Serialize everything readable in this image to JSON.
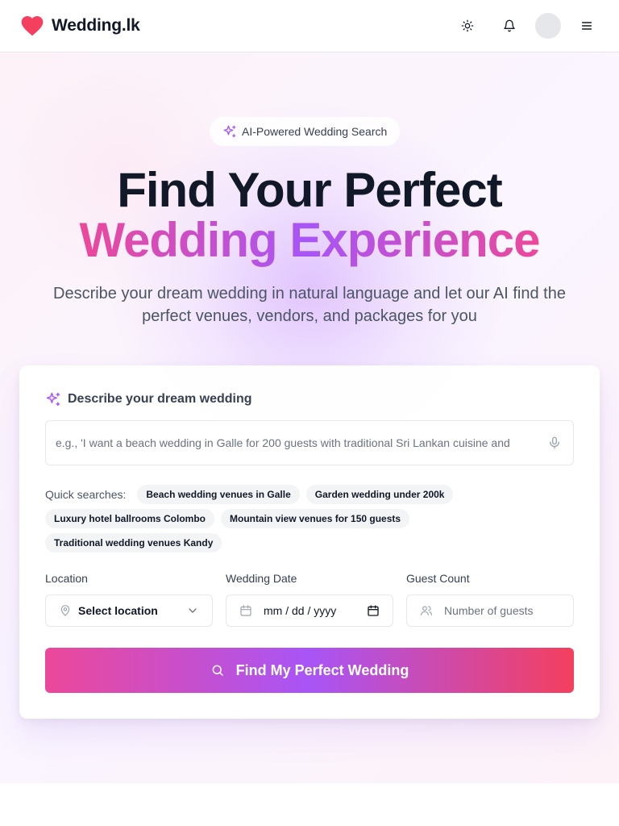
{
  "header": {
    "brand": "Wedding.lk",
    "icons": [
      "heart-icon",
      "sun-icon",
      "bell-icon",
      "avatar",
      "menu-icon"
    ]
  },
  "hero": {
    "badge": "AI-Powered Wedding Search",
    "title_line1": "Find Your Perfect",
    "title_line2": "Wedding Experience",
    "subtitle": "Describe your dream wedding in natural language and let our AI find the perfect venues, vendors, and packages for you"
  },
  "search": {
    "label": "Describe your dream wedding",
    "placeholder": "e.g., 'I want a beach wedding in Galle for 200 guests with traditional Sri Lankan cuisine and",
    "quick_label": "Quick searches:",
    "quick_searches": [
      "Beach wedding venues in Galle",
      "Garden wedding under 200k",
      "Luxury hotel ballrooms Colombo",
      "Mountain view venues for 150 guests",
      "Traditional wedding venues Kandy"
    ],
    "location_label": "Location",
    "location_value": "Select location",
    "date_label": "Wedding Date",
    "date_value": "mm / dd / yyyy",
    "guest_label": "Guest Count",
    "guest_placeholder": "Number of guests",
    "submit_label": "Find My Perfect Wedding"
  },
  "colors": {
    "brand_pink": "#ec4899",
    "brand_purple": "#a855f7",
    "heart_red": "#f43f5e"
  }
}
